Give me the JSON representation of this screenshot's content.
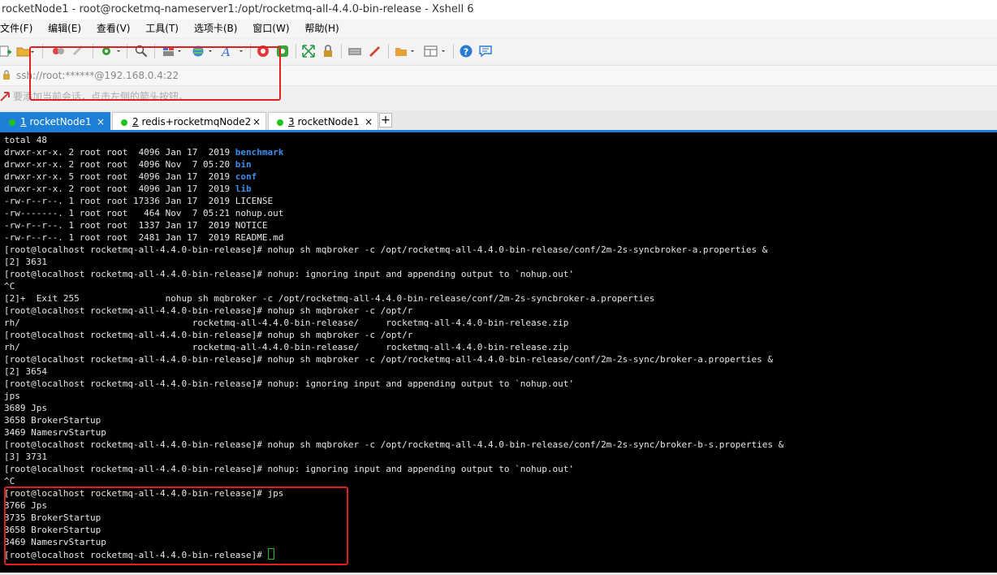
{
  "window": {
    "title": "rocketNode1 - root@rocketmq-nameserver1:/opt/rocketmq-all-4.4.0-bin-release - Xshell 6"
  },
  "menu": [
    {
      "label": "文件(F)"
    },
    {
      "label": "编辑(E)"
    },
    {
      "label": "查看(V)"
    },
    {
      "label": "工具(T)"
    },
    {
      "label": "选项卡(B)"
    },
    {
      "label": "窗口(W)"
    },
    {
      "label": "帮助(H)"
    }
  ],
  "address": {
    "value": "ssh://root:******@192.168.0.4:22"
  },
  "hint": {
    "text": "要添加当前会话，点击左侧的箭头按钮。"
  },
  "tabs": [
    {
      "num": "1",
      "label": "rocketNode1",
      "active": true
    },
    {
      "num": "2",
      "label": "redis+rocketmqNode2",
      "active": false
    },
    {
      "num": "3",
      "label": "rocketNode1",
      "active": false
    }
  ],
  "terminal": {
    "lines": [
      {
        "text": "total 48"
      },
      {
        "text": "drwxr-xr-x. 2 root root  4096 Jan 17  2019 ",
        "dir": "benchmark"
      },
      {
        "text": "drwxr-xr-x. 2 root root  4096 Nov  7 05:20 ",
        "dir": "bin"
      },
      {
        "text": "drwxr-xr-x. 5 root root  4096 Jan 17  2019 ",
        "dir": "conf"
      },
      {
        "text": "drwxr-xr-x. 2 root root  4096 Jan 17  2019 ",
        "dir": "lib"
      },
      {
        "text": "-rw-r--r--. 1 root root 17336 Jan 17  2019 LICENSE"
      },
      {
        "text": "-rw-------. 1 root root   464 Nov  7 05:21 nohup.out"
      },
      {
        "text": "-rw-r--r--. 1 root root  1337 Jan 17  2019 NOTICE"
      },
      {
        "text": "-rw-r--r--. 1 root root  2481 Jan 17  2019 README.md"
      },
      {
        "text": "[root@localhost rocketmq-all-4.4.0-bin-release]# nohup sh mqbroker -c /opt/rocketmq-all-4.4.0-bin-release/conf/2m-2s-syncbroker-a.properties &"
      },
      {
        "text": "[2] 3631"
      },
      {
        "text": "[root@localhost rocketmq-all-4.4.0-bin-release]# nohup: ignoring input and appending output to `nohup.out'"
      },
      {
        "text": "^C"
      },
      {
        "text": "[2]+  Exit 255                nohup sh mqbroker -c /opt/rocketmq-all-4.4.0-bin-release/conf/2m-2s-syncbroker-a.properties"
      },
      {
        "text": "[root@localhost rocketmq-all-4.4.0-bin-release]# nohup sh mqbroker -c /opt/r"
      },
      {
        "text": "rh/                                rocketmq-all-4.4.0-bin-release/     rocketmq-all-4.4.0-bin-release.zip"
      },
      {
        "text": "[root@localhost rocketmq-all-4.4.0-bin-release]# nohup sh mqbroker -c /opt/r"
      },
      {
        "text": "rh/                                rocketmq-all-4.4.0-bin-release/     rocketmq-all-4.4.0-bin-release.zip"
      },
      {
        "text": "[root@localhost rocketmq-all-4.4.0-bin-release]# nohup sh mqbroker -c /opt/rocketmq-all-4.4.0-bin-release/conf/2m-2s-sync/broker-a.properties &"
      },
      {
        "text": "[2] 3654"
      },
      {
        "text": "[root@localhost rocketmq-all-4.4.0-bin-release]# nohup: ignoring input and appending output to `nohup.out'"
      },
      {
        "text": "jps"
      },
      {
        "text": "3689 Jps"
      },
      {
        "text": "3658 BrokerStartup"
      },
      {
        "text": "3469 NamesrvStartup"
      },
      {
        "text": "[root@localhost rocketmq-all-4.4.0-bin-release]# nohup sh mqbroker -c /opt/rocketmq-all-4.4.0-bin-release/conf/2m-2s-sync/broker-b-s.properties &"
      },
      {
        "text": "[3] 3731"
      },
      {
        "text": "[root@localhost rocketmq-all-4.4.0-bin-release]# nohup: ignoring input and appending output to `nohup.out'"
      },
      {
        "text": "^C"
      },
      {
        "text": "[root@localhost rocketmq-all-4.4.0-bin-release]# jps"
      },
      {
        "text": "3766 Jps"
      },
      {
        "text": "3735 BrokerStartup"
      },
      {
        "text": "3658 BrokerStartup"
      },
      {
        "text": "3469 NamesrvStartup"
      },
      {
        "text": "[root@localhost rocketmq-all-4.4.0-bin-release]# ",
        "cursor": true
      }
    ]
  },
  "colors": {
    "tab_active": "#1e7fd7",
    "dir": "#3b8eea",
    "cursor": "#1ec31e",
    "highlight": "#e02020"
  }
}
